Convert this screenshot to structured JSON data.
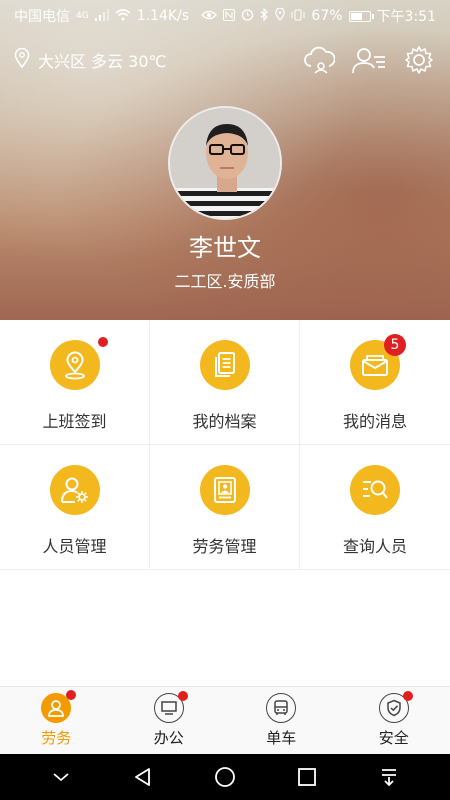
{
  "status_bar": {
    "carrier": "中国电信",
    "network": "4G",
    "speed": "1.14K/s",
    "battery": "67%",
    "battery_level": 0.67,
    "time": "下午3:51",
    "icons": [
      "eye-icon",
      "nfc-icon",
      "alarm-icon",
      "bluetooth-icon",
      "location-icon",
      "vibrate-icon",
      "battery-icon"
    ]
  },
  "header": {
    "location_weather": "大兴区 多云 30℃",
    "icons": [
      "cloud-user-icon",
      "contacts-icon",
      "gear-icon"
    ]
  },
  "profile": {
    "name": "李世文",
    "department": "二工区.安质部"
  },
  "grid": [
    {
      "label": "上班签到",
      "icon": "location-pin-icon",
      "dot": true
    },
    {
      "label": "我的档案",
      "icon": "document-icon",
      "dot": false
    },
    {
      "label": "我的消息",
      "icon": "envelope-icon",
      "badge": "5"
    },
    {
      "label": "人员管理",
      "icon": "person-gear-icon",
      "dot": false
    },
    {
      "label": "劳务管理",
      "icon": "id-card-icon",
      "dot": false
    },
    {
      "label": "查询人员",
      "icon": "search-list-icon",
      "dot": false
    }
  ],
  "bottom_nav": [
    {
      "label": "劳务",
      "icon": "person-icon",
      "active": true,
      "dot": true
    },
    {
      "label": "办公",
      "icon": "monitor-icon",
      "active": false,
      "dot": true
    },
    {
      "label": "单车",
      "icon": "bus-icon",
      "active": false,
      "dot": false
    },
    {
      "label": "安全",
      "icon": "shield-check-icon",
      "active": false,
      "dot": true
    }
  ],
  "colors": {
    "accent": "#f4b81f",
    "active_tab": "#f39a00",
    "badge": "#e02020"
  }
}
